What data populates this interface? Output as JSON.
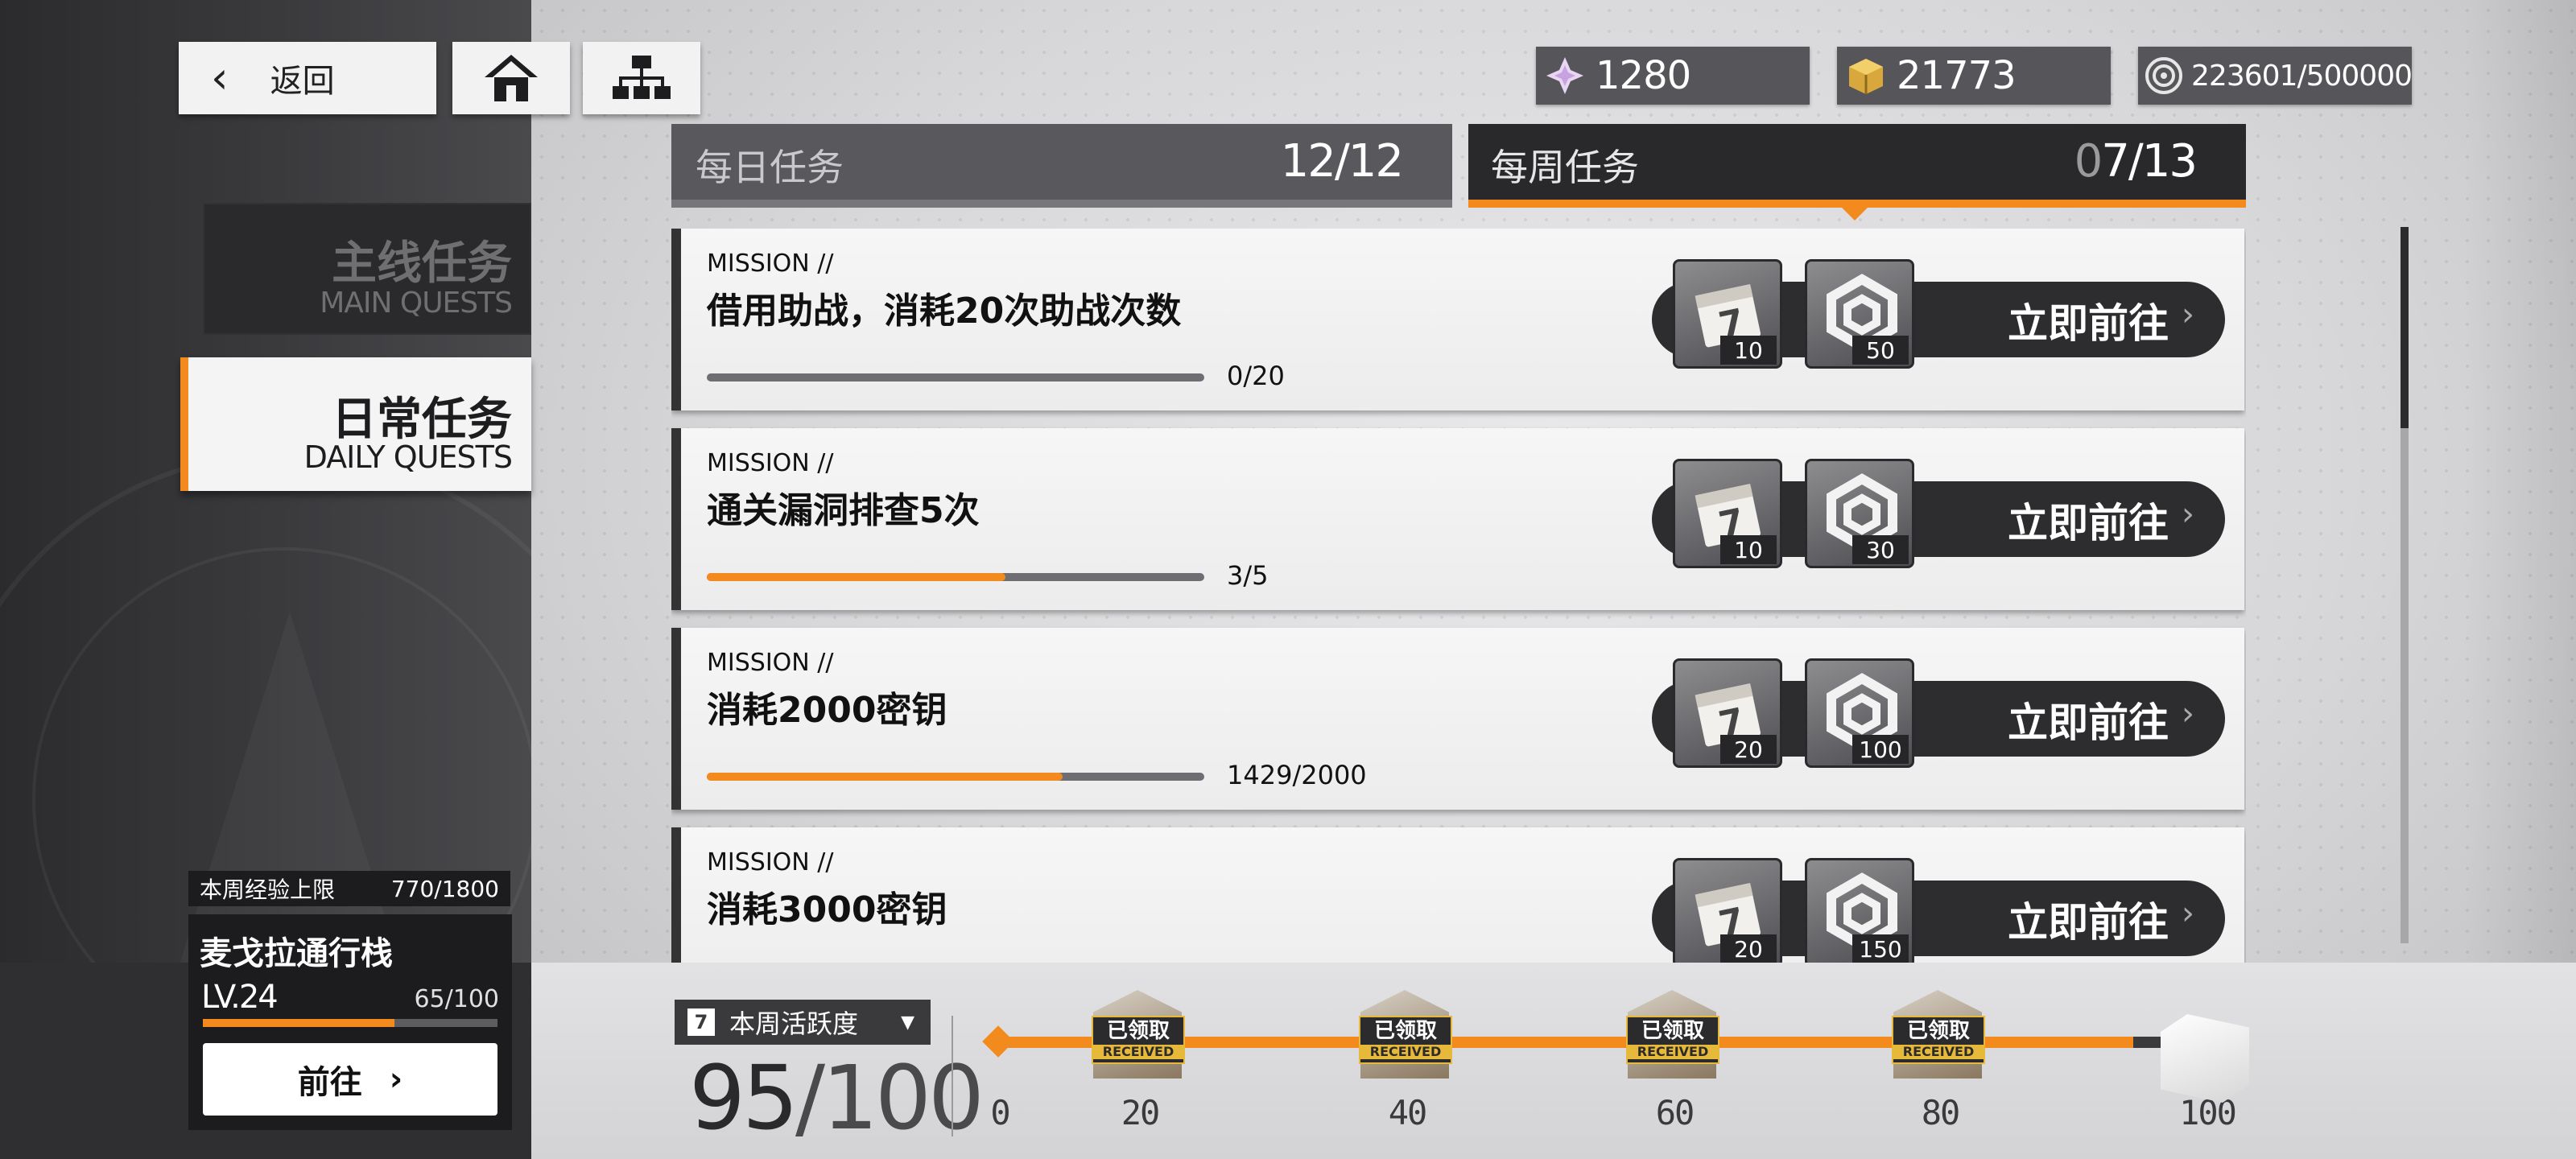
{
  "nav": {
    "back_label": "返回"
  },
  "currencies": {
    "gems": "1280",
    "gold": "21773",
    "exp": "223601/500000"
  },
  "side_tabs": {
    "main": {
      "zh": "主线任务",
      "en": "MAIN QUESTS"
    },
    "daily": {
      "zh": "日常任务",
      "en": "DAILY QUESTS"
    }
  },
  "station": {
    "weekly_exp_label": "本周经验上限",
    "weekly_exp_value": "770/1800",
    "name": "麦戈拉通行栈",
    "level": "LV.24",
    "progress_text": "65/100",
    "progress": 0.65,
    "go_label": "前往",
    "go_arrow": "›"
  },
  "quest_tabs": {
    "daily": {
      "label": "每日任务",
      "count": "12/12"
    },
    "weekly": {
      "label": "每周任务",
      "count_dim": "0",
      "count": "7/13"
    }
  },
  "missions": [
    {
      "tag": "MISSION //",
      "title": "借用助战，消耗20次助战次数",
      "progress_text": "0/20",
      "progress": 0.0,
      "reward1": "10",
      "reward2": "50",
      "go": "立即前往"
    },
    {
      "tag": "MISSION //",
      "title": "通关漏洞排查5次",
      "progress_text": "3/5",
      "progress": 0.6,
      "reward1": "10",
      "reward2": "30",
      "go": "立即前往"
    },
    {
      "tag": "MISSION //",
      "title": "消耗2000密钥",
      "progress_text": "1429/2000",
      "progress": 0.7145,
      "reward1": "20",
      "reward2": "100",
      "go": "立即前往"
    },
    {
      "tag": "MISSION //",
      "title": "消耗3000密钥",
      "progress_text": "",
      "progress": 0.0,
      "reward1": "20",
      "reward2": "150",
      "go": "立即前往"
    }
  ],
  "activity": {
    "label": "本周活跃度",
    "calendar_icon_text": "7",
    "score": "95",
    "max": "/100",
    "ticks": [
      "0",
      "20",
      "40",
      "60",
      "80",
      "100"
    ],
    "chest_label_zh": "已领取",
    "chest_label_en": "RECEIVED"
  },
  "colors": {
    "accent": "#f28a1e",
    "dark": "#2d2d2f"
  }
}
